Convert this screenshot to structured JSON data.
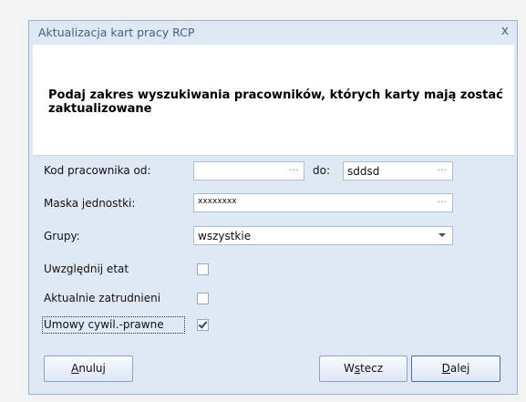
{
  "dialog": {
    "title": "Aktualizacja kart pracy RCP",
    "close_label": "x",
    "heading": "Podaj zakres wyszukiwania pracowników, których karty mają zostać zaktualizowane"
  },
  "form": {
    "kod_from_label": "Kod pracownika od:",
    "kod_from_value": "",
    "kod_to_label": "do:",
    "kod_to_value": "sddsd",
    "mask_label": "Maska jednostki:",
    "mask_value": "xxxxxxxx",
    "groups_label": "Grupy:",
    "groups_value": "wszystkie",
    "ellipsis": "···",
    "checkboxes": [
      {
        "label": "Uwzględnij etat",
        "checked": false
      },
      {
        "label": "Aktualnie zatrudnieni",
        "checked": false
      },
      {
        "label": "Umowy cywil.-prawne",
        "checked": true
      }
    ]
  },
  "buttons": {
    "cancel": {
      "mnemonic": "A",
      "rest": "nuluj"
    },
    "back": {
      "pre": "W",
      "mnemonic": "s",
      "rest": "tecz"
    },
    "next": {
      "mnemonic": "D",
      "rest": "alej"
    }
  },
  "colors": {
    "dialog_bg": "#dfe9f6",
    "title_text": "#4a5f7a",
    "check_mark": "#214a8c"
  }
}
